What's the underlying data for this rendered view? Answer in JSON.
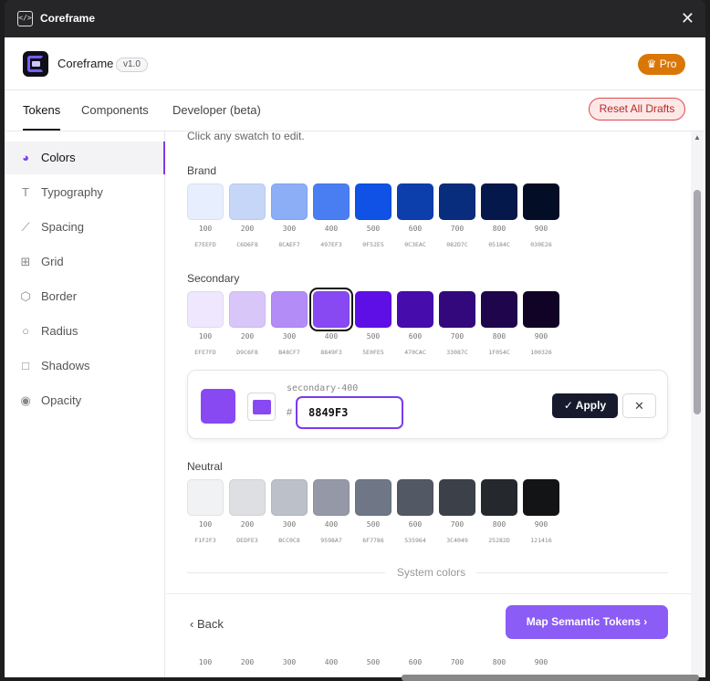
{
  "titlebar": {
    "icon": "</>",
    "title": "Coreframe",
    "close": "✕"
  },
  "header": {
    "app_name": "Coreframe",
    "version": "v1.0",
    "pro_label": "♛ Pro"
  },
  "tabs": [
    {
      "label": "Tokens",
      "active": true
    },
    {
      "label": "Components",
      "active": false
    },
    {
      "label": "Developer (beta)",
      "active": false
    }
  ],
  "reset_label": "Reset All Drafts",
  "sidebar": {
    "items": [
      {
        "label": "Colors",
        "icon": "palette-icon",
        "glyph": "◕",
        "active": true
      },
      {
        "label": "Typography",
        "icon": "type-icon",
        "glyph": "T",
        "active": false
      },
      {
        "label": "Spacing",
        "icon": "ruler-icon",
        "glyph": "⟋",
        "active": false
      },
      {
        "label": "Grid",
        "icon": "grid-icon",
        "glyph": "⊞",
        "active": false
      },
      {
        "label": "Border",
        "icon": "cube-icon",
        "glyph": "⬡",
        "active": false
      },
      {
        "label": "Radius",
        "icon": "circle-icon",
        "glyph": "○",
        "active": false
      },
      {
        "label": "Shadows",
        "icon": "square-icon",
        "glyph": "□",
        "active": false
      },
      {
        "label": "Opacity",
        "icon": "eye-icon",
        "glyph": "◉",
        "active": false
      }
    ]
  },
  "content": {
    "hint": "Click any swatch to edit.",
    "sections": [
      {
        "label": "Brand",
        "swatches": [
          {
            "step": "100",
            "hex": "E7EEFD"
          },
          {
            "step": "200",
            "hex": "C6D6F8"
          },
          {
            "step": "300",
            "hex": "8CAEF7"
          },
          {
            "step": "400",
            "hex": "497EF3"
          },
          {
            "step": "500",
            "hex": "0F52E5"
          },
          {
            "step": "600",
            "hex": "0C3EAC"
          },
          {
            "step": "700",
            "hex": "082D7C"
          },
          {
            "step": "800",
            "hex": "05184C"
          },
          {
            "step": "900",
            "hex": "030E26"
          }
        ]
      },
      {
        "label": "Secondary",
        "swatches": [
          {
            "step": "100",
            "hex": "EFE7FD"
          },
          {
            "step": "200",
            "hex": "D9C6F8"
          },
          {
            "step": "300",
            "hex": "B48CF7"
          },
          {
            "step": "400",
            "hex": "8849F3",
            "selected": true
          },
          {
            "step": "500",
            "hex": "5E0FE5"
          },
          {
            "step": "600",
            "hex": "470CAC"
          },
          {
            "step": "700",
            "hex": "33087C"
          },
          {
            "step": "800",
            "hex": "1F054C"
          },
          {
            "step": "900",
            "hex": "100326"
          }
        ]
      },
      {
        "label": "Neutral",
        "swatches": [
          {
            "step": "100",
            "hex": "F1F2F3"
          },
          {
            "step": "200",
            "hex": "DEDFE3"
          },
          {
            "step": "300",
            "hex": "BCC0C8"
          },
          {
            "step": "400",
            "hex": "9598A7"
          },
          {
            "step": "500",
            "hex": "6F7786"
          },
          {
            "step": "600",
            "hex": "535964"
          },
          {
            "step": "700",
            "hex": "3C4049"
          },
          {
            "step": "800",
            "hex": "25282D"
          },
          {
            "step": "900",
            "hex": "121416"
          }
        ]
      }
    ],
    "editor": {
      "token": "secondary-400",
      "hash": "#",
      "value": "8849F3",
      "color": "#8849F3",
      "apply_label": "✓ Apply",
      "cancel_label": "✕"
    },
    "system_colors_label": "System colors",
    "bottom_steps": [
      "100",
      "200",
      "300",
      "400",
      "500",
      "600",
      "700",
      "800",
      "900"
    ]
  },
  "footer": {
    "back_label": "‹   Back",
    "map_label": "Map Semantic Tokens  ›"
  }
}
